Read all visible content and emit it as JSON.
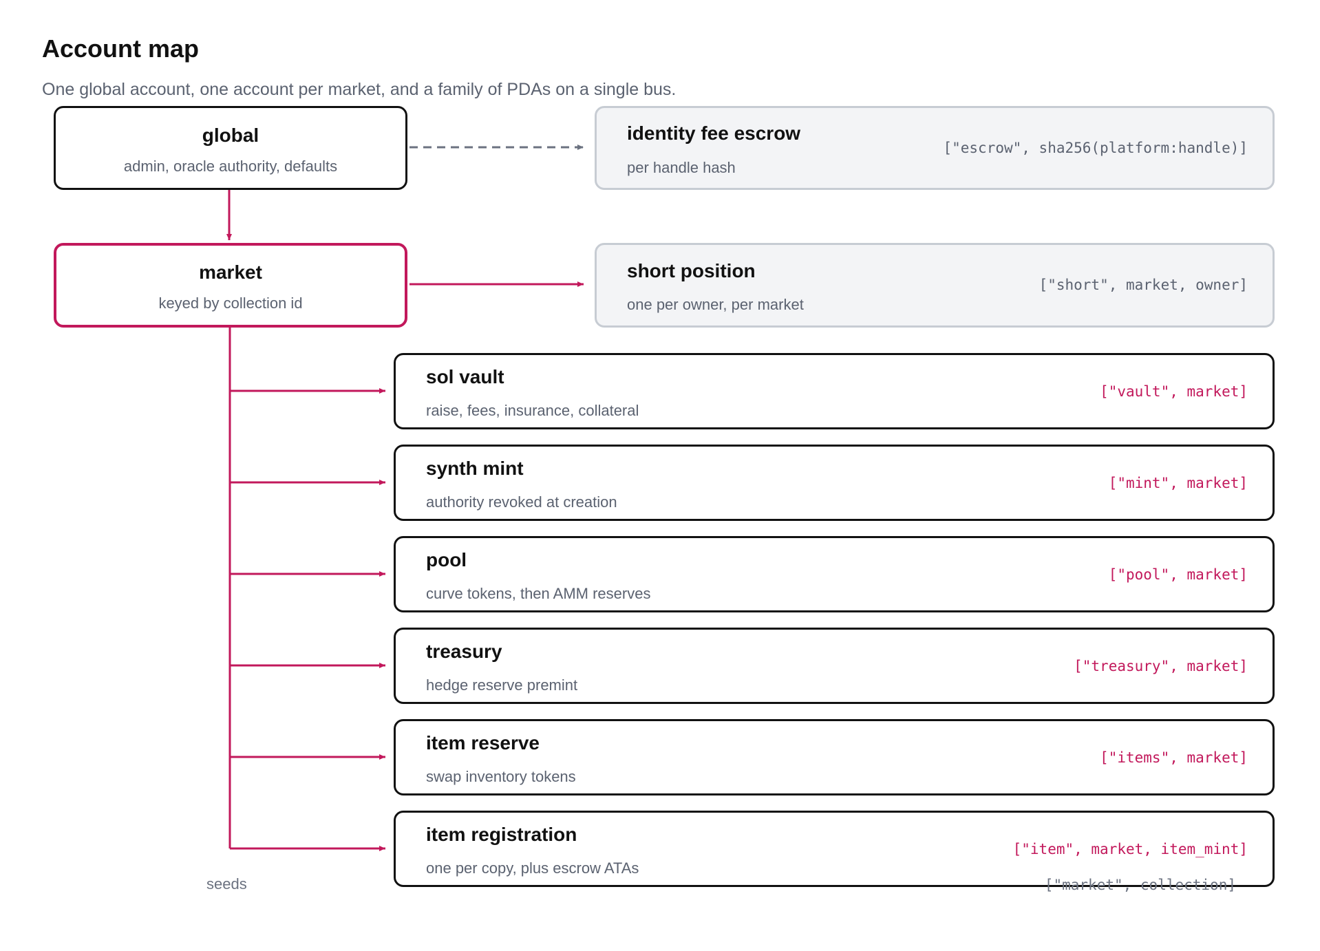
{
  "header": {
    "title": "Account map",
    "subtitle": "One global account, one account per market, and a family of PDAs on a single bus."
  },
  "colors": {
    "accent": "#c2185b",
    "text": "#111111",
    "muted": "#5b6270",
    "grey_border": "#c7ccd3",
    "grey_fill": "#f3f4f6"
  },
  "global": {
    "title": "global",
    "subtitle": "admin, oracle authority, defaults"
  },
  "market": {
    "title": "market",
    "subtitle": "keyed by collection id"
  },
  "identity_escrow": {
    "title": "identity fee escrow",
    "subtitle": "per handle hash",
    "seed": "[\"escrow\", sha256(platform:handle)]"
  },
  "short_position": {
    "title": "short position",
    "subtitle": "one per owner, per market",
    "seed": "[\"short\", market, owner]"
  },
  "pdas": [
    {
      "title": "sol vault",
      "subtitle": "raise, fees, insurance, collateral",
      "seed": "[\"vault\", market]"
    },
    {
      "title": "synth mint",
      "subtitle": "authority revoked at creation",
      "seed": "[\"mint\", market]"
    },
    {
      "title": "pool",
      "subtitle": "curve tokens, then AMM reserves",
      "seed": "[\"pool\", market]"
    },
    {
      "title": "treasury",
      "subtitle": "hedge reserve premint",
      "seed": "[\"treasury\", market]"
    },
    {
      "title": "item reserve",
      "subtitle": "swap inventory tokens",
      "seed": "[\"items\", market]"
    },
    {
      "title": "item registration",
      "subtitle": "one per copy, plus escrow ATAs",
      "seed": "[\"item\", market, item_mint]"
    }
  ],
  "footer": {
    "seeds_label": "seeds",
    "market_seed": "[\"market\", collection]"
  }
}
